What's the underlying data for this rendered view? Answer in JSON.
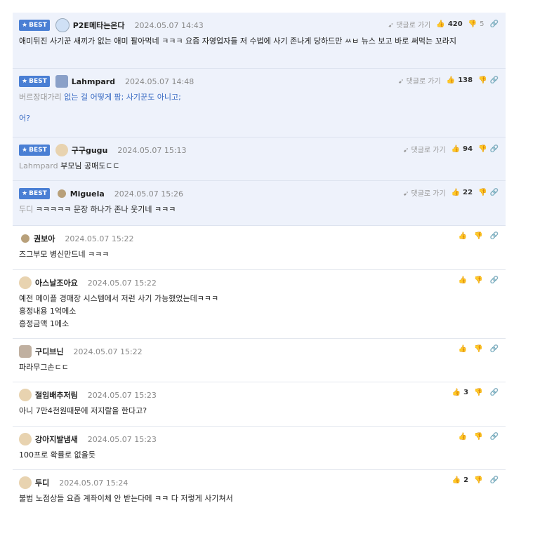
{
  "comments": [
    {
      "best": true,
      "badge": "BEST",
      "nick": "P2E메타는온다",
      "date": "2024.05.07 14:43",
      "goto": "댓글로 가기",
      "up": "420",
      "down": "5",
      "body": "애미뒤진 사기꾼 새끼가 없는 애미 팔아먹네 ㅋㅋㅋ 요즘 자영업자들 저 수법에 사기 존나게 당하드만 ㅆㅂ 뉴스 보고 바로 써먹는 꼬라지",
      "avatar": "#cfe0f5"
    },
    {
      "best": true,
      "badge": "BEST",
      "nick": "Lahmpard",
      "date": "2024.05.07 14:48",
      "goto": "댓글로 가기",
      "up": "138",
      "down": "",
      "mention": "버르장대가리",
      "body": "없는 걸 어떻게 팜; 사기꾼도 아니고;",
      "body2": "어?",
      "avatar": "#8aa0c8"
    },
    {
      "best": true,
      "badge": "BEST",
      "nick": "구구gugu",
      "date": "2024.05.07 15:13",
      "goto": "댓글로 가기",
      "up": "94",
      "down": "",
      "mention": "Lahmpard",
      "body": "부모님 공매도ㄷㄷ",
      "avatar": "#e8d3b0"
    },
    {
      "best": true,
      "badge": "BEST",
      "nick": "Miguela",
      "date": "2024.05.07 15:26",
      "goto": "댓글로 가기",
      "up": "22",
      "down": "",
      "mention": "두디",
      "body": "ㅋㅋㅋㅋㅋ 문장 하나가 존나 웃기네 ㅋㅋㅋ",
      "avatar": "#b8a07a"
    },
    {
      "best": false,
      "nick": "권보아",
      "date": "2024.05.07 15:22",
      "up": "",
      "down": "",
      "body": "즈그부모 병신만드네 ㅋㅋㅋ",
      "avatar": "#b8a07a"
    },
    {
      "best": false,
      "nick": "아스날조아요",
      "date": "2024.05.07 15:22",
      "up": "",
      "down": "",
      "body": "예전 메이플 경매장 시스템에서 저런 사기 가능했었는데ㅋㅋㅋ\n흥정내용 1억메소\n흥정금액 1메소",
      "avatar": "#e8d3b0"
    },
    {
      "best": false,
      "nick": "구디브닌",
      "date": "2024.05.07 15:22",
      "up": "",
      "down": "",
      "body": "파라무그손ㄷㄷ",
      "avatar": "#c0b0a0"
    },
    {
      "best": false,
      "nick": "절임배추저림",
      "date": "2024.05.07 15:23",
      "up": "3",
      "down": "",
      "body": "아니 7만4천원때문에 저지랄을 한다고?",
      "avatar": "#e8d3b0"
    },
    {
      "best": false,
      "nick": "강아지발냄새",
      "date": "2024.05.07 15:23",
      "up": "",
      "down": "",
      "body": "100프로 확률로 없을듯",
      "avatar": "#e8d3b0"
    },
    {
      "best": false,
      "nick": "두디",
      "date": "2024.05.07 15:24",
      "up": "2",
      "down": "",
      "body": "불법 노점상들 요즘 계좌이체 안 받는다메 ㅋㅋ 다 저렇게 사기쳐서",
      "avatar": "#e8d3b0"
    }
  ],
  "icons": {
    "goto": "➹",
    "up": "👍",
    "down": "👎",
    "link": "🔗"
  }
}
